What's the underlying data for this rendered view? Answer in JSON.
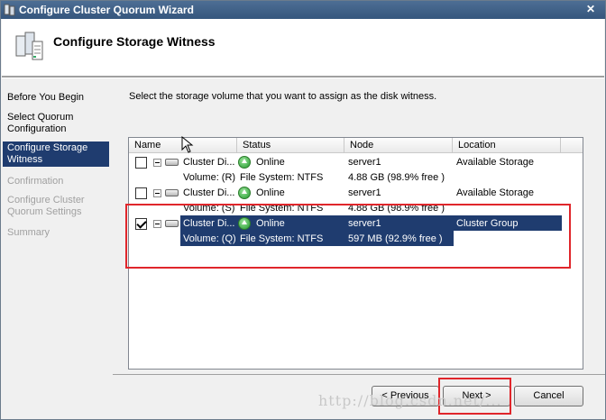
{
  "window": {
    "title": "Configure Cluster Quorum Wizard",
    "close_label": "✕"
  },
  "header": {
    "title": "Configure Storage Witness"
  },
  "nav": {
    "items": [
      {
        "label": "Before You Begin",
        "state": "normal"
      },
      {
        "label": "Select Quorum Configuration",
        "state": "normal"
      },
      {
        "label": "Configure Storage Witness",
        "state": "selected"
      },
      {
        "label": "Confirmation",
        "state": "disabled"
      },
      {
        "label": "Configure Cluster Quorum Settings",
        "state": "disabled"
      },
      {
        "label": "Summary",
        "state": "disabled"
      }
    ]
  },
  "content": {
    "instruction": "Select the storage volume that you want to assign as the disk witness.",
    "columns": [
      "Name",
      "Status",
      "Node",
      "Location"
    ],
    "rows": [
      {
        "checked": false,
        "name": "Cluster Di...",
        "status": "Online",
        "node": "server1",
        "location": "Available Storage",
        "volume": "Volume: (R)",
        "filesystem": "File System: NTFS",
        "size": "4.88 GB (98.9% free )"
      },
      {
        "checked": false,
        "name": "Cluster Di...",
        "status": "Online",
        "node": "server1",
        "location": "Available Storage",
        "volume": "Volume: (S)",
        "filesystem": "File System: NTFS",
        "size": "4.88 GB (98.9% free )"
      },
      {
        "checked": true,
        "name": "Cluster Di...",
        "status": "Online",
        "node": "server1",
        "location": "Cluster Group",
        "volume": "Volume: (Q)",
        "filesystem": "File System: NTFS",
        "size": "597 MB (92.9% free )"
      }
    ]
  },
  "buttons": {
    "previous": "< Previous",
    "next": "Next >",
    "cancel": "Cancel"
  },
  "watermark": "http://blog.csdn.net/...",
  "colors": {
    "selection": "#1f3c6f",
    "highlight": "#e0262b",
    "titlebar": "#3f6088"
  }
}
